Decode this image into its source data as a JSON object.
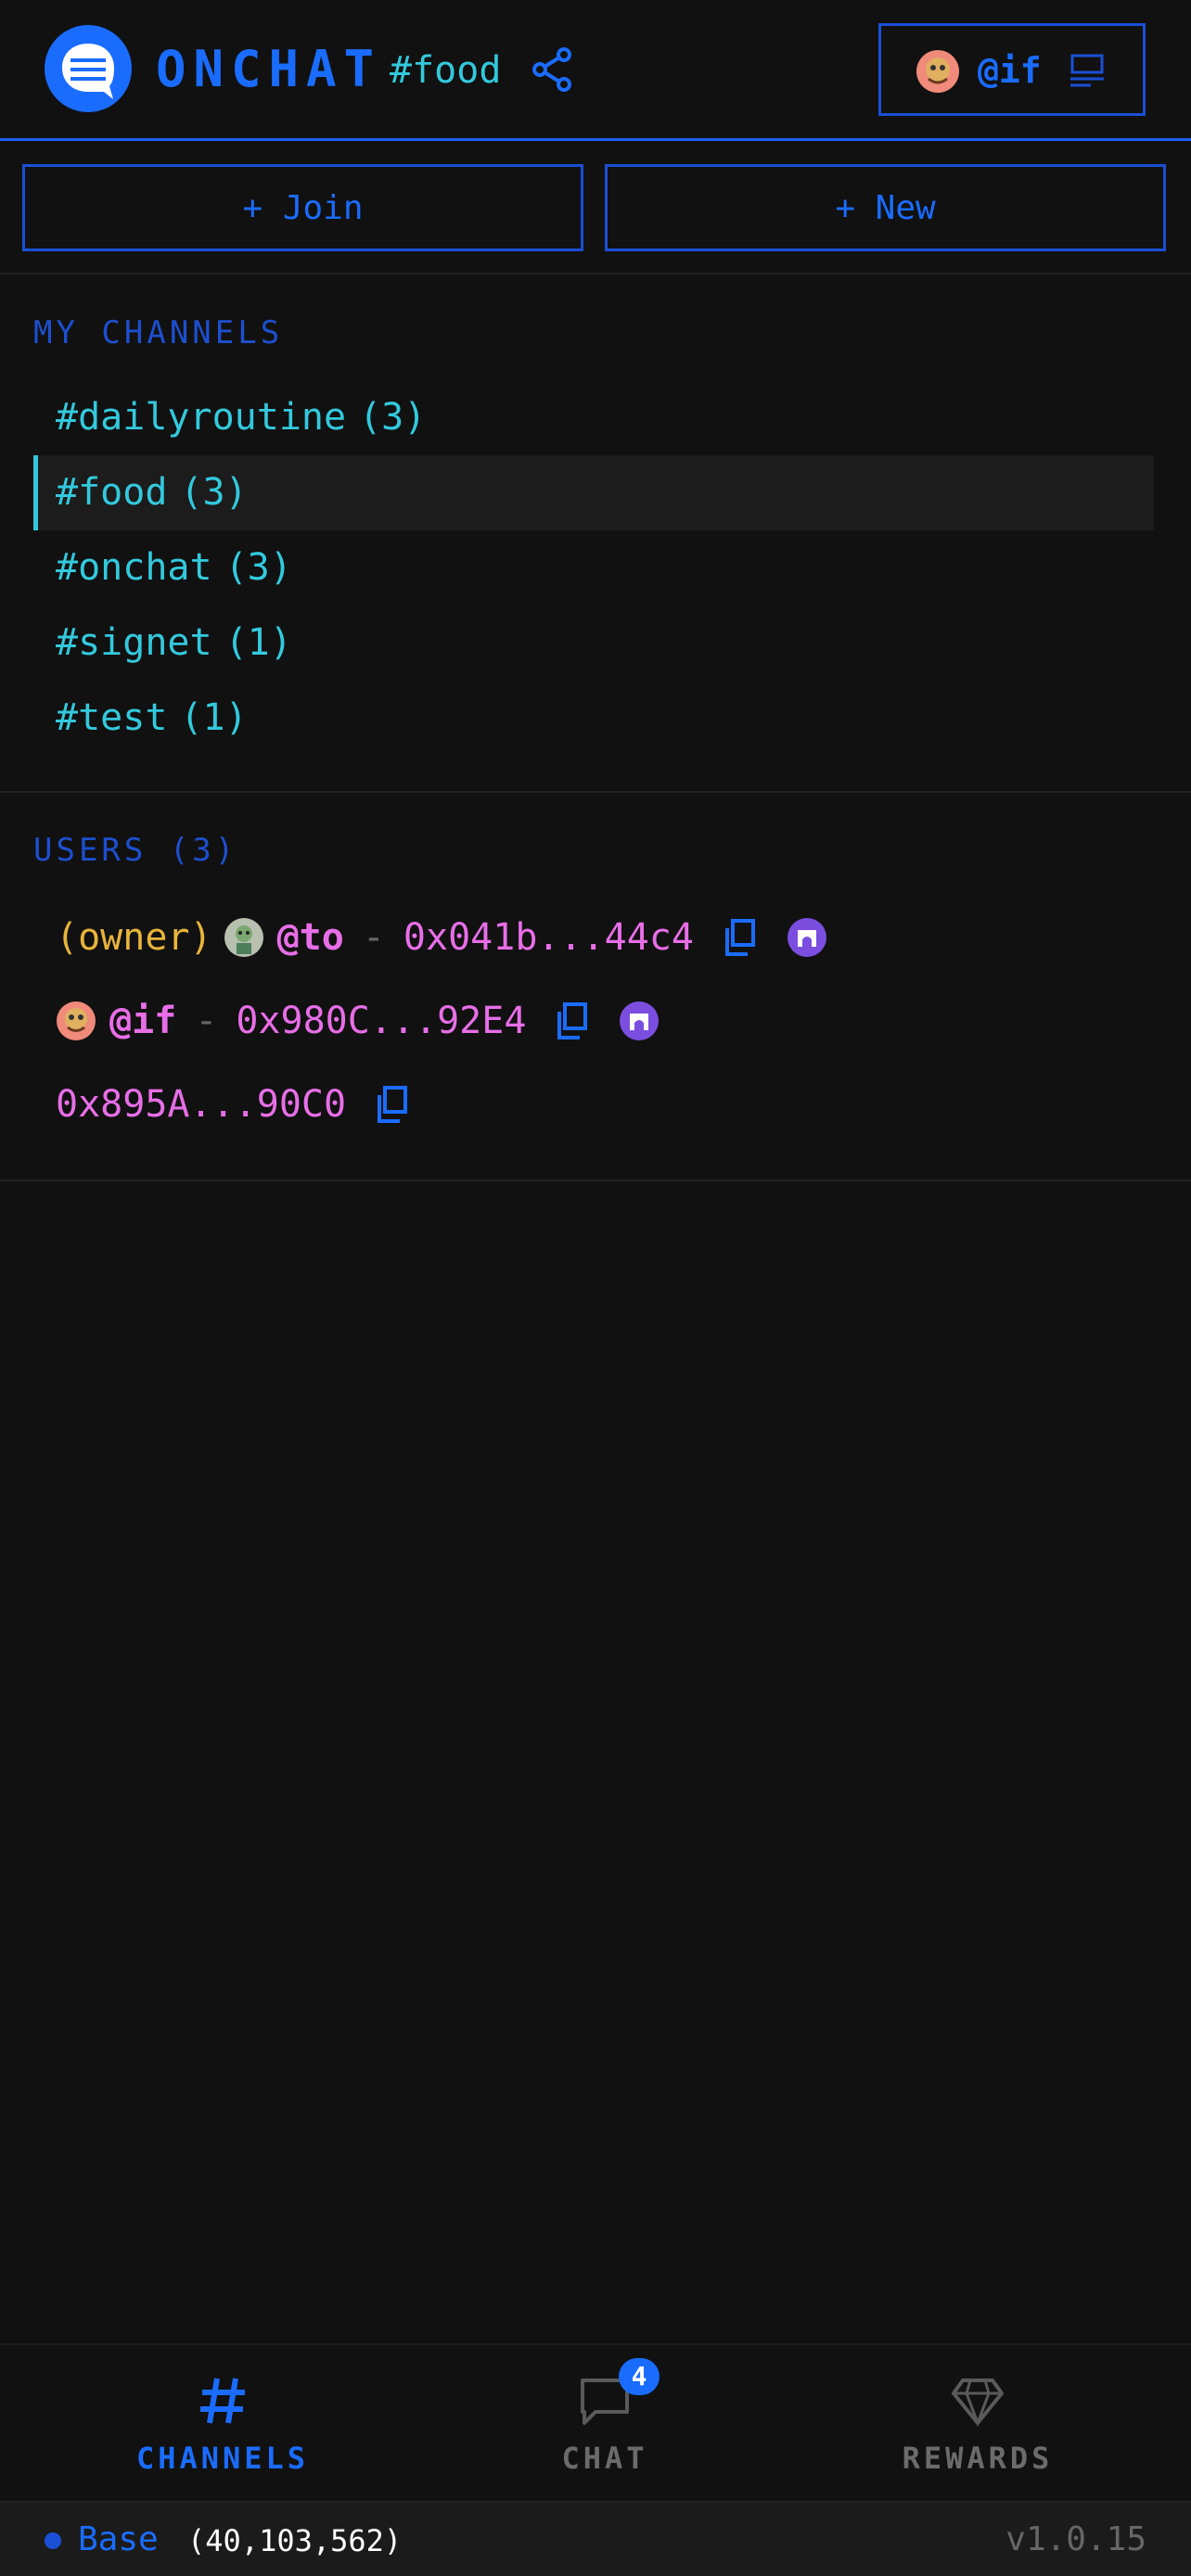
{
  "colors": {
    "accent": "#1a6cff",
    "channel": "#33c9dd",
    "user": "#e86ee8",
    "owner": "#e8b43a",
    "background": "#111111"
  },
  "header": {
    "brand": "ONCHAT",
    "current_channel": "#food",
    "profile_name": "@if"
  },
  "actions": {
    "join_label": "+ Join",
    "new_label": "+ New"
  },
  "channels": {
    "title": "MY CHANNELS",
    "items": [
      {
        "name": "#dailyroutine",
        "count": "(3)"
      },
      {
        "name": "#food",
        "count": "(3)"
      },
      {
        "name": "#onchat",
        "count": "(3)"
      },
      {
        "name": "#signet",
        "count": "(1)"
      },
      {
        "name": "#test",
        "count": "(1)"
      }
    ]
  },
  "users": {
    "title": "USERS (3)",
    "items": [
      {
        "tag": "(owner)",
        "name": "@to",
        "separator": "-",
        "address": "0x041b...44c4"
      },
      {
        "name": "@if",
        "separator": "-",
        "address": "0x980C...92E4"
      },
      {
        "address": "0x895A...90C0"
      }
    ]
  },
  "nav": {
    "channels_label": "CHANNELS",
    "chat_label": "CHAT",
    "chat_badge": "4",
    "rewards_label": "REWARDS"
  },
  "status": {
    "chain": "Base",
    "block": "(40,103,562)",
    "version": "v1.0.15"
  }
}
